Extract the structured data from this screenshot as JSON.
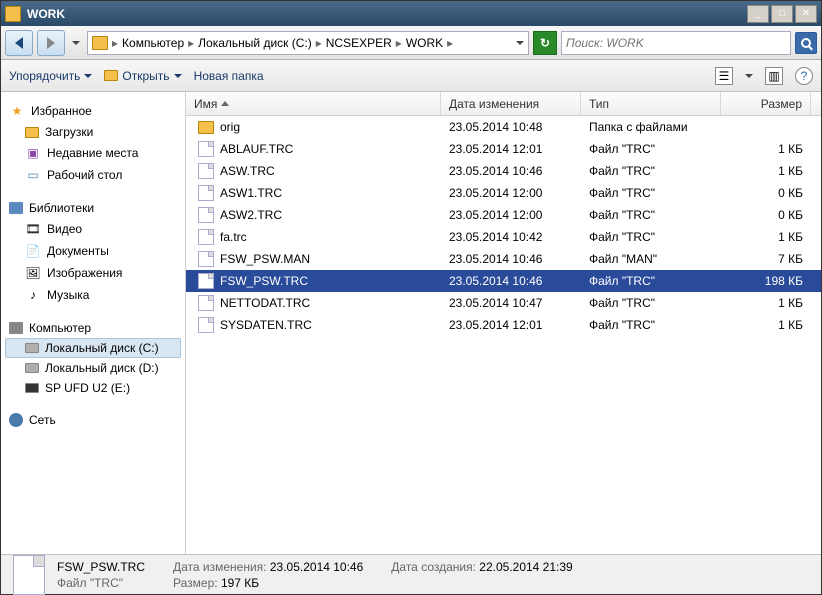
{
  "window": {
    "title": "WORK"
  },
  "breadcrumb": [
    "Компьютер",
    "Локальный диск (C:)",
    "NCSEXPER",
    "WORK"
  ],
  "search": {
    "placeholder": "Поиск: WORK"
  },
  "toolbar": {
    "organize": "Упорядочить",
    "open": "Открыть",
    "newfolder": "Новая папка"
  },
  "sidebar": {
    "favorites": {
      "label": "Избранное",
      "items": [
        "Загрузки",
        "Недавние места",
        "Рабочий стол"
      ]
    },
    "libraries": {
      "label": "Библиотеки",
      "items": [
        "Видео",
        "Документы",
        "Изображения",
        "Музыка"
      ]
    },
    "computer": {
      "label": "Компьютер",
      "items": [
        "Локальный диск (C:)",
        "Локальный диск (D:)",
        "SP UFD U2 (E:)"
      ],
      "selected": 0
    },
    "network": {
      "label": "Сеть"
    }
  },
  "columns": {
    "name": "Имя",
    "date": "Дата изменения",
    "type": "Тип",
    "size": "Размер"
  },
  "files": [
    {
      "name": "orig",
      "date": "23.05.2014 10:48",
      "type": "Папка с файлами",
      "size": "",
      "folder": true
    },
    {
      "name": "ABLAUF.TRC",
      "date": "23.05.2014 12:01",
      "type": "Файл \"TRC\"",
      "size": "1 КБ"
    },
    {
      "name": "ASW.TRC",
      "date": "23.05.2014 10:46",
      "type": "Файл \"TRC\"",
      "size": "1 КБ"
    },
    {
      "name": "ASW1.TRC",
      "date": "23.05.2014 12:00",
      "type": "Файл \"TRC\"",
      "size": "0 КБ"
    },
    {
      "name": "ASW2.TRC",
      "date": "23.05.2014 12:00",
      "type": "Файл \"TRC\"",
      "size": "0 КБ"
    },
    {
      "name": "fa.trc",
      "date": "23.05.2014 10:42",
      "type": "Файл \"TRC\"",
      "size": "1 КБ"
    },
    {
      "name": "FSW_PSW.MAN",
      "date": "23.05.2014 10:46",
      "type": "Файл \"MAN\"",
      "size": "7 КБ"
    },
    {
      "name": "FSW_PSW.TRC",
      "date": "23.05.2014 10:46",
      "type": "Файл \"TRC\"",
      "size": "198 КБ",
      "selected": true
    },
    {
      "name": "NETTODAT.TRC",
      "date": "23.05.2014 10:47",
      "type": "Файл \"TRC\"",
      "size": "1 КБ"
    },
    {
      "name": "SYSDATEN.TRC",
      "date": "23.05.2014 12:01",
      "type": "Файл \"TRC\"",
      "size": "1 КБ"
    }
  ],
  "status": {
    "name": "FSW_PSW.TRC",
    "type": "Файл \"TRC\"",
    "mod_label": "Дата изменения:",
    "mod": "23.05.2014 10:46",
    "create_label": "Дата создания:",
    "create": "22.05.2014 21:39",
    "size_label": "Размер:",
    "size": "197 КБ"
  }
}
